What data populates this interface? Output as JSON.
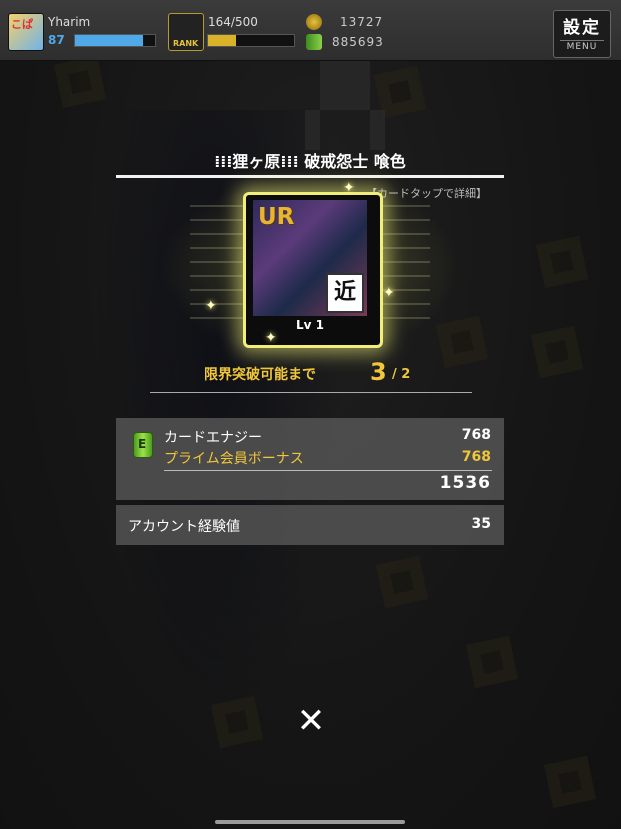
{
  "hud": {
    "username": "Yharim",
    "level": "87",
    "level_progress": 0.85,
    "stamina": "164/500",
    "stamina_progress": 0.33,
    "currency_1": "13727",
    "currency_2": "885693",
    "avatar_text": "こぱ",
    "rank_text": "RANK",
    "settings_kanji": "設定",
    "settings_label": "MENU"
  },
  "card": {
    "title": "⁞⁞⁞狸ヶ原⁞⁞⁞ 破戒怨士 喰色",
    "tap_hint": "【カードタップで詳細】",
    "rarity": "UR",
    "type": "近",
    "level_label": "Lv 1"
  },
  "limit_break": {
    "label": "限界突破可能まで",
    "current": "3",
    "max": "/ 2"
  },
  "energy": {
    "icon_text": "E",
    "card_energy_label": "カードエナジー",
    "card_energy_value": "768",
    "bonus_label": "プライム会員ボーナス",
    "bonus_value": "768",
    "total": "1536"
  },
  "account": {
    "exp_label": "アカウント経験値",
    "exp_value": "35"
  },
  "colors": {
    "accent_gold": "#f0c63a",
    "glow": "#f1ef7a",
    "exp_bar": "#4fa8e8",
    "stamina_bar": "#d9b22a"
  },
  "icons": {
    "close": "close-icon",
    "energy": "energy-can-icon",
    "coin": "coin-icon"
  }
}
